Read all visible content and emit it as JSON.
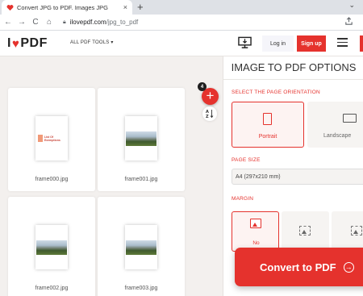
{
  "browser": {
    "tab_title": "Convert JPG to PDF. Images JPG",
    "tab_close": "×",
    "new_tab": "+",
    "url_domain": "ilovepdf.com",
    "url_path": "/jpg_to_pdf",
    "back": "←",
    "forward": "→",
    "reload": "C",
    "home": "⌂",
    "menu": "⌄"
  },
  "header": {
    "logo_left": "I",
    "logo_heart": "♥",
    "logo_right": "PDF",
    "tools_menu": "ALL PDF TOOLS ▾",
    "login": "Log in",
    "signup": "Sign up",
    "brand_color": "#e5322d"
  },
  "workspace": {
    "file_count": "4",
    "add_symbol": "+",
    "sort_label": "A↓Z",
    "files": [
      {
        "name": "frame000.jpg",
        "thumb": "certificate",
        "cert_text": "List Of Exemptions"
      },
      {
        "name": "frame001.jpg",
        "thumb": "photo"
      },
      {
        "name": "frame002.jpg",
        "thumb": "photo"
      },
      {
        "name": "frame003.jpg",
        "thumb": "photo"
      }
    ]
  },
  "sidebar": {
    "title": "IMAGE TO PDF OPTIONS",
    "orientation_label": "SELECT THE PAGE ORIENTATION",
    "portrait": "Portrait",
    "landscape": "Landscape",
    "page_size_label": "PAGE SIZE",
    "page_size_value": "A4 (297x210 mm)",
    "margin_label": "MARGIN",
    "margin_no": "No",
    "convert_label": "Convert to PDF",
    "convert_arrow": "→"
  }
}
